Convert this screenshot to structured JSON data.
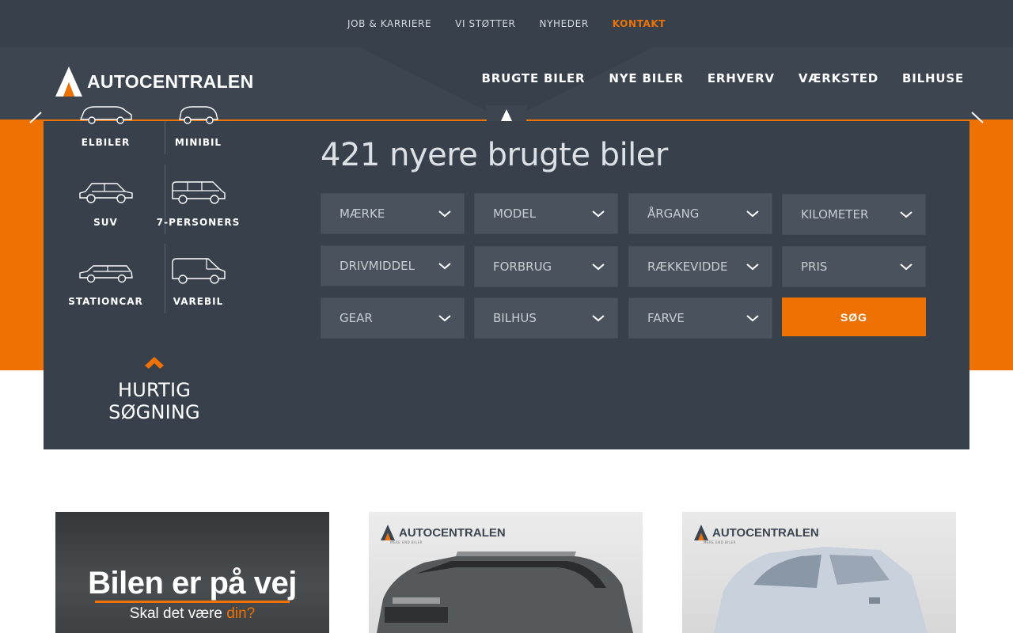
{
  "topbar": {
    "links": [
      "JOB & KARRIERE",
      "VI STØTTER",
      "NYHEDER",
      "KONTAKT"
    ],
    "active": "KONTAKT"
  },
  "brand": {
    "name": "AUTOCENTRALEN",
    "accent_color": "#ee7203",
    "dark_color": "#38414b"
  },
  "mainnav": [
    "BRUGTE BILER",
    "NYE BILER",
    "ERHVERV",
    "VÆRKSTED",
    "BILHUSE"
  ],
  "categories": [
    {
      "label": "ELBILER",
      "icon": "electric-car-icon"
    },
    {
      "label": "MINIBIL",
      "icon": "mini-car-icon"
    },
    {
      "label": "SUV",
      "icon": "suv-icon"
    },
    {
      "label": "7-PERSONERS",
      "icon": "minivan-icon"
    },
    {
      "label": "STATIONCAR",
      "icon": "stationcar-icon"
    },
    {
      "label": "VAREBIL",
      "icon": "van-icon"
    }
  ],
  "quick_search": {
    "label": "HURTIG SØGNING",
    "icon": "chevron-up-icon"
  },
  "search": {
    "title": "421 nyere brugte biler",
    "filters": [
      "MÆRKE",
      "MODEL",
      "ÅRGANG",
      "KILOMETER",
      "DRIVMIDDEL",
      "FORBRUG",
      "RÆKKEVIDDE",
      "PRIS",
      "GEAR",
      "BILHUS",
      "FARVE"
    ],
    "submit_label": "SØG"
  },
  "cards": {
    "promo_headline": "Bilen er på vej",
    "promo_sub_prefix": "Skal det være ",
    "promo_sub_accent": "din?",
    "card_logo": "AUTOCENTRALEN",
    "card_logo_sub": "MERE END BILER"
  }
}
